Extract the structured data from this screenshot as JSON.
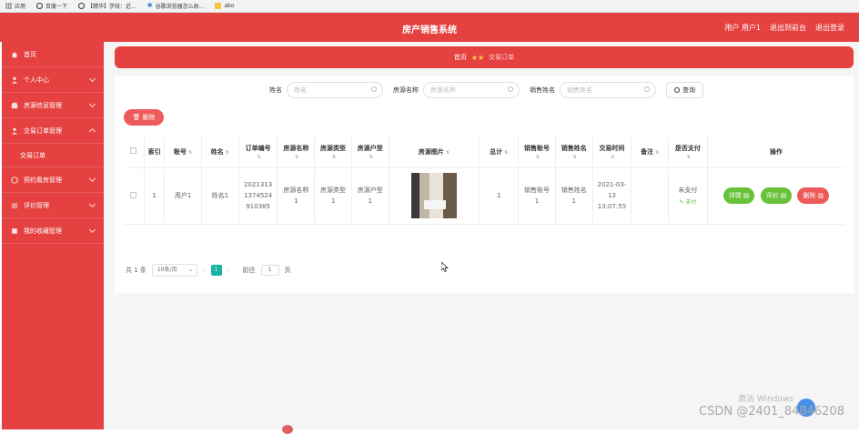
{
  "bookmarks": [
    {
      "icon": "apps-grid-icon",
      "label": "应用"
    },
    {
      "icon": "globe-icon",
      "label": "百度一下"
    },
    {
      "icon": "globe-icon",
      "label": "【精华】学校：近..."
    },
    {
      "icon": "star-icon",
      "label": "谷歌浏览器怎么收..."
    },
    {
      "icon": "folder-icon",
      "label": "abo"
    }
  ],
  "header": {
    "title": "房产销售系统",
    "user_label": "用户 用户1",
    "back_label": "退出到前台",
    "logout_label": "退出登录"
  },
  "sidebar": {
    "items": [
      {
        "label": "首页",
        "icon": "home-icon"
      },
      {
        "label": "个人中心",
        "icon": "user-icon"
      },
      {
        "label": "房源信息管理",
        "icon": "building-icon"
      },
      {
        "label": "交易订单管理",
        "icon": "user-icon"
      },
      {
        "label": "交易订单",
        "icon": ""
      },
      {
        "label": "预约看房管理",
        "icon": "calendar-icon"
      },
      {
        "label": "评价管理",
        "icon": "list-icon"
      },
      {
        "label": "我的收藏管理",
        "icon": "bookmark-icon"
      }
    ]
  },
  "breadcrumb": {
    "home": "首页",
    "current": "交易订单"
  },
  "search": {
    "name_label": "姓名",
    "name_placeholder": "姓名",
    "house_label": "房源名称",
    "house_placeholder": "房源名称",
    "seller_label": "销售姓名",
    "seller_placeholder": "销售姓名",
    "search_button": "查询"
  },
  "toolbar": {
    "delete_label": "删除"
  },
  "table": {
    "headers": [
      "索引",
      "账号",
      "姓名",
      "订单编号",
      "房源名称",
      "房源类型",
      "房源户型",
      "房源图片",
      "总计",
      "销售账号",
      "销售姓名",
      "交易时间",
      "备注",
      "是否支付",
      "操作"
    ],
    "rows": [
      {
        "index": "1",
        "account": "用户1",
        "name": "姓名1",
        "order_no": "2021313 1374524 910385",
        "house_name": "房源名称 1",
        "house_type": "房源类型 1",
        "house_layout": "房源户型 1",
        "total": "1",
        "seller_account": "销售账号 1",
        "seller_name": "销售姓名 1",
        "trade_time": "2021-03-13 13:07:55",
        "remark": "",
        "pay_status": "未支付",
        "pay_link": "支付",
        "actions": {
          "detail": "详情",
          "review": "评价",
          "delete": "删除"
        }
      }
    ]
  },
  "pager": {
    "total": "共 1 条",
    "page_size": "10条/页",
    "current_page": "1",
    "goto_label": "前往",
    "goto_value": "1",
    "page_unit": "页"
  },
  "overlay": {
    "windows_text": "激活 Windows",
    "csdn_text": "CSDN @2401_84846208"
  }
}
